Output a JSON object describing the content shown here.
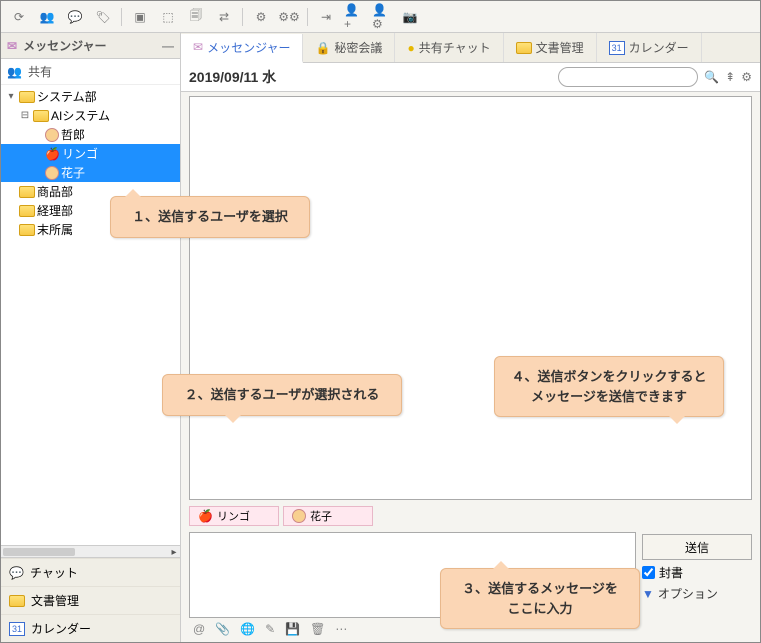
{
  "sidebar": {
    "header": "メッセンジャー",
    "shared": "共有",
    "tree": {
      "n0": "システム部",
      "n1": "AIシステム",
      "u0": "哲郎",
      "u1": "リンゴ",
      "u2": "花子",
      "n2": "商品部",
      "n3": "経理部",
      "n4": "末所属"
    },
    "bottom": {
      "chat": "チャット",
      "docs": "文書管理",
      "calendar": "カレンダー",
      "cal_num": "31"
    }
  },
  "tabs": {
    "messenger": "メッセンジャー",
    "secret": "秘密会議",
    "shared_chat": "共有チャット",
    "docs": "文書管理",
    "calendar": "カレンダー",
    "cal_num": "31"
  },
  "datebar": {
    "date": "2019/09/11 水",
    "search_placeholder": ""
  },
  "recipients": {
    "r0": "リンゴ",
    "r1": "花子"
  },
  "compose": {
    "send": "送信",
    "sealed": "封書",
    "options": "オプション"
  },
  "callouts": {
    "c1": "１、送信するユーザを選択",
    "c2": "２、送信するユーザが選択される",
    "c3": "３、送信するメッセージを\nここに入力",
    "c4": "４、送信ボタンをクリックすると\nメッセージを送信できます"
  }
}
